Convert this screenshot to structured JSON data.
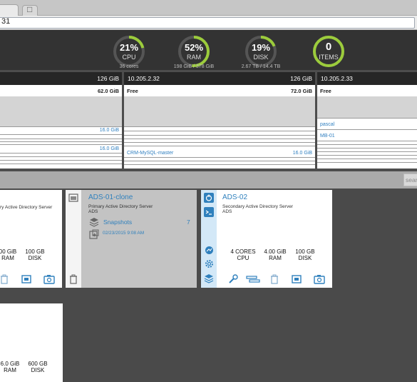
{
  "browser": {
    "address_text": "31"
  },
  "stats": [
    {
      "id": "cpu",
      "value": "21%",
      "label": "CPU",
      "sub": "36 cores",
      "percent": 21
    },
    {
      "id": "ram",
      "value": "52%",
      "label": "RAM",
      "sub": "198 GiB / 378 GiB",
      "percent": 52
    },
    {
      "id": "disk",
      "value": "19%",
      "label": "DISK",
      "sub": "2.67 TB / 14.4 TB",
      "percent": 19
    },
    {
      "id": "items",
      "value": "0",
      "label": "ITEMS",
      "sub": "",
      "percent": 100
    }
  ],
  "colors": {
    "gauge_accent": "#9ccc3c",
    "link_blue": "#2f80bd",
    "header_dark": "#333333"
  },
  "hosts": [
    {
      "ip": "",
      "size": "126 GiB",
      "free_label": "",
      "free_value": "62.0 GiB",
      "vms": [
        {
          "name": "",
          "size": "16.0 GiB"
        },
        {
          "name": "",
          "size": "16.0 GiB"
        }
      ]
    },
    {
      "ip": "10.205.2.32",
      "size": "126 GiB",
      "free_label": "Free",
      "free_value": "72.0 GiB",
      "vms": [
        {
          "name": "CRM-MySQL-master",
          "size": "16.0 GiB"
        }
      ]
    },
    {
      "ip": "10.205.2.33",
      "size": "",
      "free_label": "Free",
      "free_value": "",
      "vms": [
        {
          "name": "pascal",
          "size": ""
        },
        {
          "name": "MB-01",
          "size": ""
        }
      ]
    }
  ],
  "search": {
    "placeholder": "sear"
  },
  "cards": {
    "left": {
      "desc_line1": "ry Active Directory Server",
      "cpu_value": "",
      "ram_value": "00 GiB",
      "ram_label": "RAM",
      "disk_value": "100 GB",
      "disk_label": "DISK"
    },
    "clone": {
      "title": "ADS-01-clone",
      "desc_line1": "Primary Active Directory Server",
      "desc_line2": "ADS",
      "snapshots_label": "Snapshots",
      "snapshots_count": "7",
      "snapshot_date": "02/23/2015 9:08 AM"
    },
    "ads02": {
      "title": "ADS-02",
      "desc_line1": "Secondary Active Directory Server",
      "desc_line2": "ADS",
      "cpu_value": "4 CORES",
      "cpu_label": "CPU",
      "ram_value": "4.00 GiB",
      "ram_label": "RAM",
      "disk_value": "100 GB",
      "disk_label": "DISK"
    },
    "lower": {
      "ram_value": "6.0 GiB",
      "ram_label": "RAM",
      "disk_value": "600 GB",
      "disk_label": "DISK"
    }
  }
}
